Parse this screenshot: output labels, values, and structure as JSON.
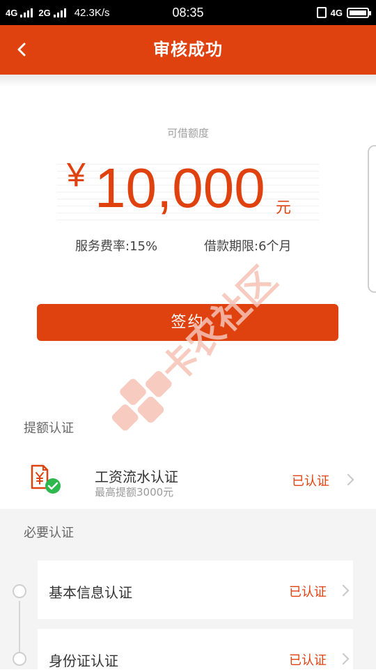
{
  "status_bar": {
    "net1": "4G",
    "net2": "2G",
    "speed": "42.3K/s",
    "time": "08:35",
    "right_net": "4G"
  },
  "header": {
    "title": "审核成功",
    "back_icon": "chevron-left-icon"
  },
  "amount": {
    "label": "可借额度",
    "currency": "¥",
    "value": "10,000",
    "unit": "元"
  },
  "terms": {
    "fee_rate": "服务费率:15%",
    "loan_term": "借款期限:6个月"
  },
  "sign_button": "签约",
  "watermark": {
    "text": "卡农社区"
  },
  "raise_section": {
    "title": "提额认证",
    "items": [
      {
        "icon": "yuan-document-check-icon",
        "title": "工资流水认证",
        "subtitle": "最高提额3000元",
        "status": "已认证"
      }
    ]
  },
  "required_section": {
    "title": "必要认证",
    "items": [
      {
        "label": "基本信息认证",
        "status": "已认证"
      },
      {
        "label": "身份证认证",
        "status": "已认证"
      }
    ]
  },
  "colors": {
    "accent": "#e0420f",
    "success": "#2db84d",
    "watermark": "#f6c2b6"
  }
}
